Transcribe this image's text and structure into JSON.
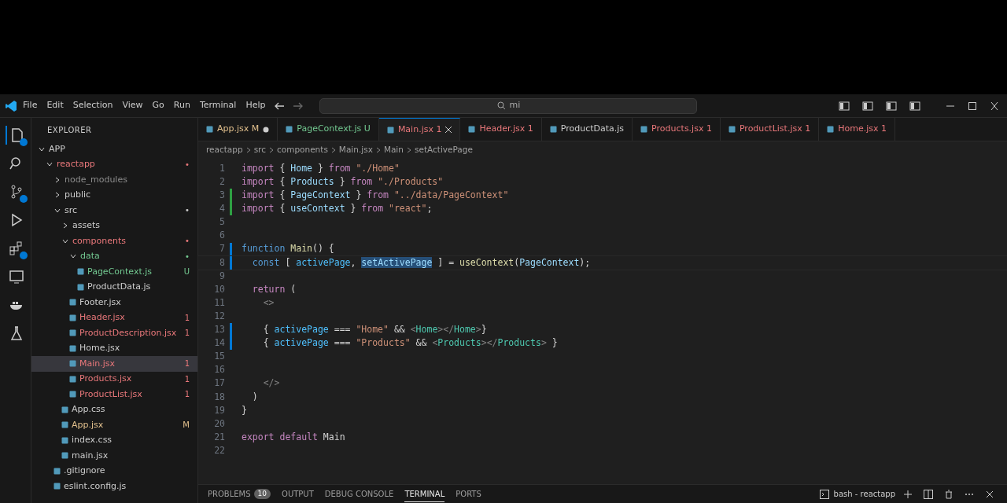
{
  "title_bar": {
    "menu": [
      "File",
      "Edit",
      "Selection",
      "View",
      "Go",
      "Run",
      "Terminal",
      "Help"
    ],
    "search": "mi"
  },
  "activity_bar": [
    {
      "selected": true,
      "badge": true
    },
    {
      "selected": false,
      "badge": false
    },
    {
      "selected": false,
      "badge": true
    },
    {
      "selected": false,
      "badge": false
    },
    {
      "selected": false,
      "badge": true
    },
    {
      "selected": false,
      "badge": false
    },
    {
      "selected": false,
      "badge": false
    },
    {
      "selected": false,
      "badge": false
    }
  ],
  "sidebar": {
    "title": "EXPLORER",
    "items": [
      {
        "label": "APP",
        "kind": "folder",
        "expanded": true,
        "color": "#cccccc",
        "children": [
          {
            "label": "reactapp",
            "kind": "folder",
            "expanded": true,
            "color": "#e8777a",
            "badge": "•",
            "children": [
              {
                "label": "node_modules",
                "kind": "folder",
                "expanded": false,
                "color": "#8c8c8c"
              },
              {
                "label": "public",
                "kind": "folder",
                "expanded": false,
                "color": "#cccccc"
              },
              {
                "label": "src",
                "kind": "folder",
                "expanded": true,
                "color": "#cccccc",
                "badge": "•",
                "children": [
                  {
                    "label": "assets",
                    "kind": "folder",
                    "expanded": false,
                    "color": "#cccccc"
                  },
                  {
                    "label": "components",
                    "kind": "folder",
                    "expanded": true,
                    "color": "#e8777a",
                    "badge": "•",
                    "children": [
                      {
                        "label": "data",
                        "kind": "folder",
                        "expanded": true,
                        "color": "#73c991",
                        "badge": "•",
                        "children": [
                          {
                            "label": "PageContext.js",
                            "kind": "file",
                            "color": "#73c991",
                            "badge": "U",
                            "selected": false
                          },
                          {
                            "label": "ProductData.js",
                            "kind": "file",
                            "color": "#cccccc",
                            "selected": false
                          }
                        ]
                      },
                      {
                        "label": "Footer.jsx",
                        "kind": "file",
                        "color": "#cccccc",
                        "selected": false
                      },
                      {
                        "label": "Header.jsx",
                        "kind": "file",
                        "color": "#e8777a",
                        "badge": "1",
                        "selected": false
                      },
                      {
                        "label": "ProductDescription.jsx",
                        "kind": "file",
                        "color": "#e8777a",
                        "badge": "1",
                        "selected": false
                      },
                      {
                        "label": "Home.jsx",
                        "kind": "file",
                        "color": "#cccccc",
                        "selected": false
                      },
                      {
                        "label": "Main.jsx",
                        "kind": "file",
                        "color": "#e8777a",
                        "badge": "1",
                        "selected": true
                      },
                      {
                        "label": "Products.jsx",
                        "kind": "file",
                        "color": "#e8777a",
                        "badge": "1",
                        "selected": false
                      },
                      {
                        "label": "ProductList.jsx",
                        "kind": "file",
                        "color": "#e8777a",
                        "badge": "1",
                        "selected": false
                      }
                    ]
                  },
                  {
                    "label": "App.css",
                    "kind": "file",
                    "color": "#cccccc",
                    "selected": false
                  },
                  {
                    "label": "App.jsx",
                    "kind": "file",
                    "color": "#e2c08d",
                    "badge": "M",
                    "selected": false
                  },
                  {
                    "label": "index.css",
                    "kind": "file",
                    "color": "#cccccc",
                    "selected": false
                  },
                  {
                    "label": "main.jsx",
                    "kind": "file",
                    "color": "#cccccc",
                    "selected": false
                  }
                ]
              },
              {
                "label": ".gitignore",
                "kind": "file",
                "color": "#cccccc",
                "selected": false
              },
              {
                "label": "eslint.config.js",
                "kind": "file",
                "color": "#cccccc",
                "selected": false
              }
            ]
          }
        ]
      }
    ]
  },
  "tabs": [
    {
      "label": "App.jsx",
      "status": "M",
      "dirty": true,
      "selected": false,
      "color": "#e2c08d"
    },
    {
      "label": "PageContext.js",
      "status": "U",
      "dirty": false,
      "selected": false,
      "color": "#73c991"
    },
    {
      "label": "Main.jsx",
      "status": "1",
      "dirty": false,
      "selected": true,
      "color": "#e8777a"
    },
    {
      "label": "Header.jsx",
      "status": "1",
      "dirty": false,
      "selected": false,
      "color": "#e8777a"
    },
    {
      "label": "ProductData.js",
      "dirty": false,
      "selected": false,
      "color": "#cccccc"
    },
    {
      "label": "Products.jsx",
      "status": "1",
      "dirty": false,
      "selected": false,
      "color": "#e8777a"
    },
    {
      "label": "ProductList.jsx",
      "status": "1",
      "dirty": false,
      "selected": false,
      "color": "#e8777a"
    },
    {
      "label": "Home.jsx",
      "status": "1",
      "dirty": false,
      "selected": false,
      "color": "#e8777a"
    }
  ],
  "breadcrumb": [
    "reactapp",
    "src",
    "components",
    "Main.jsx",
    "Main",
    "setActivePage"
  ],
  "code": [
    {
      "n": "1",
      "tokens": [
        {
          "kind": "kw",
          "text": "import"
        },
        {
          "kind": "plain",
          "text": " { "
        },
        {
          "kind": "var",
          "text": "Home"
        },
        {
          "kind": "plain",
          "text": " } "
        },
        {
          "kind": "kw",
          "text": "from"
        },
        {
          "kind": "str",
          "text": " \"./Home\""
        }
      ]
    },
    {
      "n": "2",
      "tokens": [
        {
          "kind": "kw",
          "text": "import"
        },
        {
          "kind": "plain",
          "text": " { "
        },
        {
          "kind": "var",
          "text": "Products"
        },
        {
          "kind": "plain",
          "text": " } "
        },
        {
          "kind": "kw",
          "text": "from"
        },
        {
          "kind": "str",
          "text": " \"./Products\""
        }
      ]
    },
    {
      "n": "3",
      "color": "#2ea043",
      "tokens": [
        {
          "kind": "kw",
          "text": "import"
        },
        {
          "kind": "plain",
          "text": " { "
        },
        {
          "kind": "var",
          "text": "PageContext"
        },
        {
          "kind": "plain",
          "text": " } "
        },
        {
          "kind": "kw",
          "text": "from"
        },
        {
          "kind": "str",
          "text": " \"../data/PageContext\""
        }
      ]
    },
    {
      "n": "4",
      "color": "#2ea043",
      "tokens": [
        {
          "kind": "kw",
          "text": "import"
        },
        {
          "kind": "plain",
          "text": " { "
        },
        {
          "kind": "var",
          "text": "useContext"
        },
        {
          "kind": "plain",
          "text": " } "
        },
        {
          "kind": "kw",
          "text": "from"
        },
        {
          "kind": "str",
          "text": " \"react\""
        },
        {
          "kind": "plain",
          "text": ";"
        }
      ]
    },
    {
      "n": "5"
    },
    {
      "n": "6"
    },
    {
      "n": "7",
      "color": "#0078d4",
      "tokens": [
        {
          "kind": "kw2",
          "text": "function"
        },
        {
          "kind": "fn",
          "text": " Main"
        },
        {
          "kind": "plain",
          "text": "() {"
        }
      ]
    },
    {
      "n": "8",
      "color": "#0078d4",
      "current": true,
      "tokens": [
        {
          "kind": "kw2",
          "text": "  const"
        },
        {
          "kind": "plain",
          "text": " [ "
        },
        {
          "kind": "const",
          "text": "activePage"
        },
        {
          "kind": "plain",
          "text": ", "
        },
        {
          "kind": "sel",
          "text": "setActivePage"
        },
        {
          "kind": "plain",
          "text": " ] = "
        },
        {
          "kind": "fn",
          "text": "useContext"
        },
        {
          "kind": "plain",
          "text": "("
        },
        {
          "kind": "var",
          "text": "PageContext"
        },
        {
          "kind": "plain",
          "text": ");"
        }
      ]
    },
    {
      "n": "9"
    },
    {
      "n": "10",
      "tokens": [
        {
          "kind": "kw",
          "text": "  return"
        },
        {
          "kind": "plain",
          "text": " ("
        }
      ]
    },
    {
      "n": "11",
      "tokens": [
        {
          "kind": "tag",
          "text": "    <>"
        }
      ]
    },
    {
      "n": "12"
    },
    {
      "n": "13",
      "color": "#0078d4",
      "tokens": [
        {
          "kind": "plain",
          "text": "    { "
        },
        {
          "kind": "const",
          "text": "activePage"
        },
        {
          "kind": "plain",
          "text": " === "
        },
        {
          "kind": "str",
          "text": "\"Home\""
        },
        {
          "kind": "plain",
          "text": " && "
        },
        {
          "kind": "tag",
          "text": "<"
        },
        {
          "kind": "comp",
          "text": "Home"
        },
        {
          "kind": "tag",
          "text": "></"
        },
        {
          "kind": "comp",
          "text": "Home"
        },
        {
          "kind": "tag",
          "text": ">"
        },
        {
          "kind": "plain",
          "text": "}"
        }
      ]
    },
    {
      "n": "14",
      "color": "#0078d4",
      "tokens": [
        {
          "kind": "plain",
          "text": "    { "
        },
        {
          "kind": "const",
          "text": "activePage"
        },
        {
          "kind": "plain",
          "text": " === "
        },
        {
          "kind": "str",
          "text": "\"Products\""
        },
        {
          "kind": "plain",
          "text": " && "
        },
        {
          "kind": "tag",
          "text": "<"
        },
        {
          "kind": "comp",
          "text": "Products"
        },
        {
          "kind": "tag",
          "text": "></"
        },
        {
          "kind": "comp",
          "text": "Products"
        },
        {
          "kind": "tag",
          "text": ">"
        },
        {
          "kind": "plain",
          "text": " }"
        }
      ]
    },
    {
      "n": "15"
    },
    {
      "n": "16"
    },
    {
      "n": "17",
      "tokens": [
        {
          "kind": "tag",
          "text": "    </>"
        }
      ]
    },
    {
      "n": "18",
      "tokens": [
        {
          "kind": "plain",
          "text": "  )"
        }
      ]
    },
    {
      "n": "19",
      "tokens": [
        {
          "kind": "plain",
          "text": "}"
        }
      ]
    },
    {
      "n": "20"
    },
    {
      "n": "21",
      "tokens": [
        {
          "kind": "kw",
          "text": "export"
        },
        {
          "kind": "kw",
          "text": " default"
        },
        {
          "kind": "plain",
          "text": " Main"
        }
      ]
    },
    {
      "n": "22"
    }
  ],
  "panel": {
    "tabs": [
      {
        "label": "PROBLEMS",
        "count": "10",
        "selected": false
      },
      {
        "label": "OUTPUT",
        "selected": false
      },
      {
        "label": "DEBUG CONSOLE",
        "selected": false
      },
      {
        "label": "TERMINAL",
        "selected": true
      },
      {
        "label": "PORTS",
        "selected": false
      }
    ],
    "terminal": "bash - reactapp"
  }
}
